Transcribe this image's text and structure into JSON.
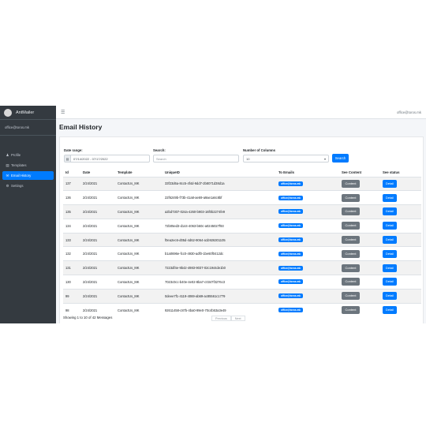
{
  "app": {
    "brand": "AntMailer",
    "user_email": "office@toros.mk",
    "top_email": "office@toros.mk",
    "menu_icon": "hamburger-icon"
  },
  "sidebar": {
    "items": [
      {
        "label": "Profile",
        "icon": "user-icon",
        "active": false
      },
      {
        "label": "Templates",
        "icon": "file-icon",
        "active": false
      },
      {
        "label": "Email History",
        "icon": "envelope-icon",
        "active": true
      },
      {
        "label": "Settings",
        "icon": "gear-icon",
        "active": false
      }
    ]
  },
  "page": {
    "title": "Email History"
  },
  "filters": {
    "date_label": "Date range:",
    "date_value": "07/14/2022 - 07/17/2022",
    "search_label": "Search:",
    "search_placeholder": "Search",
    "columns_label": "Number of Columns",
    "columns_value": "10",
    "search_button": "Search"
  },
  "table": {
    "headers": [
      "Id",
      "Date",
      "Template",
      "UniqueID",
      "To Emails",
      "See Content",
      "See status"
    ],
    "content_button": "Content",
    "detail_button": "Detail",
    "rows": [
      {
        "id": "137",
        "date": "2/24/2021",
        "template": "ContactUs_MK",
        "uid": "33f23d6a-8cc5-4f4d-9dd7-2b8071d38d1a",
        "email": "office@toros.mk"
      },
      {
        "id": "136",
        "date": "2/24/2021",
        "template": "ContactUs_MK",
        "uid": "22f6249b-f73b-41a8-ae69-a9ae1a6c8bf",
        "email": "office@toros.mk"
      },
      {
        "id": "135",
        "date": "2/24/2021",
        "template": "ContactUs_MK",
        "uid": "a2bd7307-024a-4260-b903-16f0b2274fe9",
        "email": "office@toros.mk"
      },
      {
        "id": "134",
        "date": "2/24/2021",
        "template": "ContactUs_MK",
        "uid": "72b05ed3-d144-4063-b60c-a0245027f93",
        "email": "office@toros.mk"
      },
      {
        "id": "133",
        "date": "2/24/2021",
        "template": "ContactUs_MK",
        "uid": "f0ea2ec6-d05d-4d62-9064-a1b926301105",
        "email": "office@toros.mk"
      },
      {
        "id": "132",
        "date": "2/24/2021",
        "template": "ContactUs_MK",
        "uid": "b1a0696e-fcc0-4930-adf0-1be60f0412dc",
        "email": "office@toros.mk"
      },
      {
        "id": "131",
        "date": "2/24/2021",
        "template": "ContactUs_MK",
        "uid": "7223df4e-9b42-4983-9037-02c1944de1b0",
        "email": "office@toros.mk"
      },
      {
        "id": "130",
        "date": "2/24/2021",
        "template": "ContactUs_MK",
        "uid": "7023c0cc-b40e-4e02-8ba7-c0347f3276c3",
        "email": "office@toros.mk"
      },
      {
        "id": "99",
        "date": "2/24/2021",
        "template": "ContactUs_MK",
        "uid": "0deee7f1-4119-4069-ab69-ac85561c1779",
        "email": "office@toros.mk"
      },
      {
        "id": "98",
        "date": "2/24/2021",
        "template": "ContactUs_MK",
        "uid": "92611458-c87b-4ba0-99e0-70c4b53a3e49",
        "email": "office@toros.mk"
      }
    ]
  },
  "footer": {
    "info": "Showing 1 to 10 of 42 Messages",
    "prev": "Previous",
    "next": "Next"
  }
}
